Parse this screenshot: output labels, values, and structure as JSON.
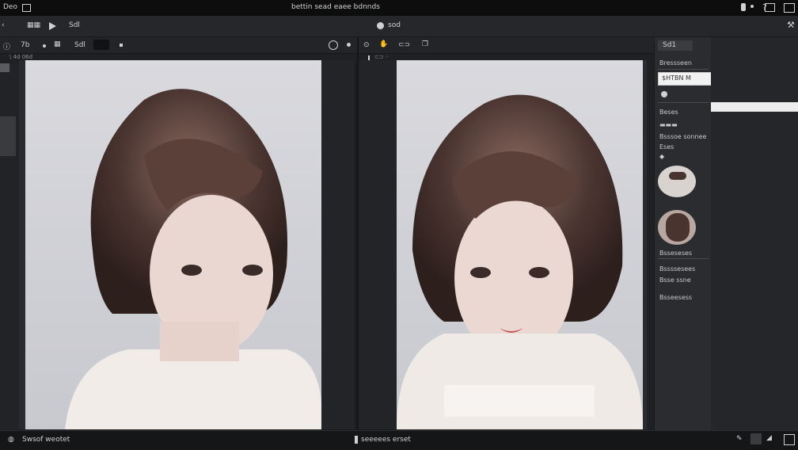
{
  "app": {
    "title_left": "Deo",
    "title_left_icon": "window-icon",
    "window_title": "bettin sead eaee bdnnds"
  },
  "toolbar": {
    "item_2": "Sdl",
    "tab_label": "sod"
  },
  "left_panel": {
    "btn_1": "7b",
    "btn_2": "Sdl",
    "subbar_label": "\\ 4d 06d"
  },
  "right_panel": {
    "btn_top": "Sd1",
    "header": "Bressseen",
    "input_value": "$HTBN M",
    "row_1": "Beses",
    "row_2": "Bsssoe sonnee",
    "row_3": "Eses",
    "list_1": "Bsseseses",
    "list_2": "Bssssesees",
    "list_3": "Bsse ssne",
    "list_4": "Bsseesess"
  },
  "status": {
    "left_text": "Swsof weotet",
    "center_text": "seeeees erset"
  },
  "colors": {
    "bg": "#1b1c1e",
    "panel": "#2b2c30",
    "accent_white": "#f2f2f2"
  }
}
